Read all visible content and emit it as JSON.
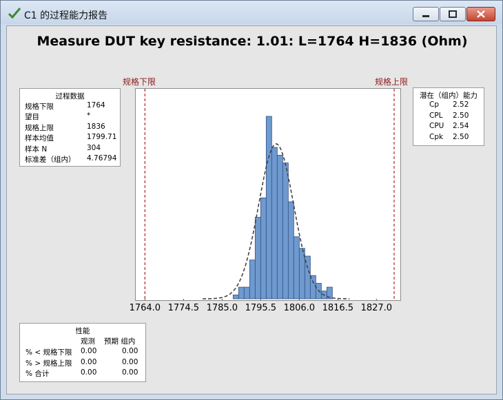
{
  "window": {
    "title": "C1 的过程能力报告",
    "icon": "check-icon"
  },
  "report": {
    "title": "Measure DUT key resistance: 1.01: L=1764 H=1836 (Ohm)",
    "lsl_label": "规格下限",
    "usl_label": "规格上限"
  },
  "process_data": {
    "header": "过程数据",
    "rows": [
      {
        "label": "规格下限",
        "value": "1764"
      },
      {
        "label": "望目",
        "value": "*"
      },
      {
        "label": "规格上限",
        "value": "1836"
      },
      {
        "label": "样本均值",
        "value": "1799.71"
      },
      {
        "label": "样本 N",
        "value": "304"
      },
      {
        "label": "标准差（组内）",
        "value": "4.76794"
      }
    ]
  },
  "capability": {
    "header": "潜在（组内）能力",
    "rows": [
      {
        "label": "Cp",
        "value": "2.52"
      },
      {
        "label": "CPL",
        "value": "2.50"
      },
      {
        "label": "CPU",
        "value": "2.54"
      },
      {
        "label": "Cpk",
        "value": "2.50"
      }
    ]
  },
  "performance": {
    "header": "性能",
    "col_observed": "观测",
    "col_expected": "预期 组内",
    "rows": [
      {
        "label": "% < 规格下限",
        "observed": "0.00",
        "expected": "0.00"
      },
      {
        "label": "% > 规格上限",
        "observed": "0.00",
        "expected": "0.00"
      },
      {
        "label": "% 合计",
        "observed": "0.00",
        "expected": "0.00"
      }
    ]
  },
  "colors": {
    "bar_fill": "#6f9ad0",
    "bar_stroke": "#2f4f80",
    "spec_line": "#b22222",
    "curve": "#444444"
  },
  "chart_data": {
    "type": "bar",
    "xlim": [
      1761.5,
      1833.5
    ],
    "x_ticks": [
      "1764.0",
      "1774.5",
      "1785.0",
      "1795.5",
      "1806.0",
      "1816.5",
      "1827.0"
    ],
    "x_tick_values": [
      1764.0,
      1774.5,
      1785.0,
      1795.5,
      1806.0,
      1816.5,
      1827.0
    ],
    "lsl": 1764,
    "usl": 1836,
    "bin_width": 1.5,
    "bin_starts": [
      1788.0,
      1789.5,
      1791.0,
      1792.5,
      1794.0,
      1795.5,
      1797.0,
      1798.5,
      1800.0,
      1801.5,
      1803.0,
      1804.5,
      1806.0,
      1807.5,
      1809.0,
      1810.5,
      1812.0,
      1813.5
    ],
    "counts": [
      1,
      3,
      3,
      10,
      21,
      26,
      47,
      39,
      37,
      35,
      25,
      16,
      13,
      11,
      6,
      4,
      2,
      3
    ],
    "normal_curve": {
      "mean": 1799.71,
      "stdev": 4.76794
    }
  }
}
